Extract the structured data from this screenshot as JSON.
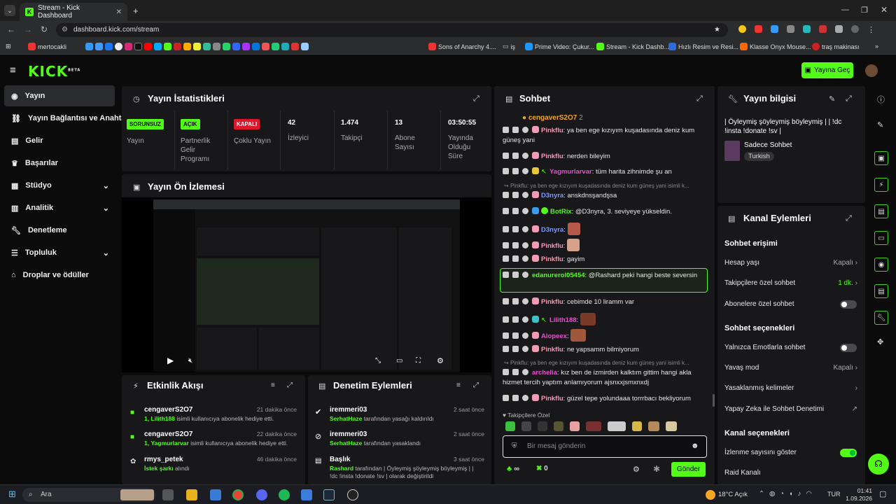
{
  "browser": {
    "tab_title": "Stream - Kick Dashboard",
    "url": "dashboard.kick.com/stream",
    "bookmarks": [
      "mertocakli",
      "Sons of Anarchy 4....",
      "iş",
      "Prime Video: Çukur...",
      "Stream - Kick Dashb...",
      "Hızlı Resim ve Resi...",
      "Klasse Onyx Mouse...",
      "traş makinası"
    ]
  },
  "header": {
    "logo": "KICK",
    "logo_sup": "BETA",
    "go_live": "Yayına Geç"
  },
  "sidebar": {
    "items": [
      {
        "label": "Yayın"
      },
      {
        "label": "Yayın Bağlantısı ve Anahtarı"
      },
      {
        "label": "Gelir"
      },
      {
        "label": "Başarılar"
      },
      {
        "label": "Stüdyo"
      },
      {
        "label": "Analitik"
      },
      {
        "label": "Denetleme"
      },
      {
        "label": "Topluluk"
      },
      {
        "label": "Droplar ve ödüller"
      }
    ]
  },
  "stats": {
    "title": "Yayın İstatistikleri",
    "items": [
      {
        "value": "SORUNSUZ",
        "label": "Yayın"
      },
      {
        "value": "AÇIK",
        "label": "Partnerlik Gelir Programı"
      },
      {
        "value": "KAPALI",
        "label": "Çoklu Yayın"
      },
      {
        "value": "42",
        "label": "İzleyici"
      },
      {
        "value": "1.474",
        "label": "Takipçi"
      },
      {
        "value": "13",
        "label": "Abone Sayısı"
      },
      {
        "value": "03:50:55",
        "label": "Yayında Olduğu Süre"
      }
    ]
  },
  "preview": {
    "title": "Yayın Ön İzlemesi"
  },
  "activity": {
    "title": "Etkinlik Akışı",
    "items": [
      {
        "user": "cengaverS2O7",
        "time": "21 dakika önce",
        "count": "1,",
        "target": "Lilith188",
        "text": "isimli kullanıcıya abonelik hediye etti."
      },
      {
        "user": "cengaverS2O7",
        "time": "22 dakika önce",
        "count": "1,",
        "target": "Yagmurlarvar",
        "text": "isimli kullanıcıya abonelik hediye etti."
      },
      {
        "user": "rmys_petek",
        "time": "46 dakika önce",
        "count": "",
        "target": "İstek şarkı",
        "text": "alındı"
      }
    ]
  },
  "moderation": {
    "title": "Denetim Eylemleri",
    "items": [
      {
        "user": "iremmeri03",
        "time": "2 saat önce",
        "actor": "SerhatHaze",
        "text": "tarafından yasağı kaldırıldı"
      },
      {
        "user": "iremmeri03",
        "time": "2 saat önce",
        "actor": "SerhatHaze",
        "text": "tarafından yasaklandı"
      },
      {
        "user": "Başlık",
        "time": "3 saat önce",
        "actor": "Rashard",
        "text": "tarafından | Öyleymiş şöyleymiş böyleymiş | | !dc !insta !donate !sv | olarak değiştirildi"
      }
    ]
  },
  "chat": {
    "title": "Sohbet",
    "pinned_user": "cengaverS2O7",
    "pinned_count": "2",
    "messages": [
      {
        "user": "Pinkflu",
        "text": "ya ben ege kızıyım kuşadasında deniz kum güneş yani",
        "color": "#f59ab4"
      },
      {
        "user": "Pinkflu",
        "text": "nerden bileyim",
        "color": "#f59ab4"
      },
      {
        "user": "Yagmurlarvar",
        "text": "tüm harita zihnimde şu an",
        "color": "#e84fd0"
      },
      {
        "user": "D3nyra",
        "text": "anskdnsşandşsa",
        "color": "#7b9cff"
      },
      {
        "user": "BotRix",
        "text": "@D3nyra, 3. seviyeye yükseldin.",
        "color": "#53fc18"
      },
      {
        "user": "D3nyra",
        "text": "",
        "color": "#7b9cff"
      },
      {
        "user": "Pinkflu",
        "text": "",
        "color": "#f59ab4"
      },
      {
        "user": "Pinkflu",
        "text": "gayim",
        "color": "#f59ab4"
      },
      {
        "user": "edanurerol05454",
        "text": "@Rashard peki hangi beste seversin",
        "color": "#53fc18"
      },
      {
        "user": "Pinkflu",
        "text": "cebimde 10 liramm var",
        "color": "#f59ab4"
      },
      {
        "user": "Lilith188",
        "text": "",
        "color": "#e84fd0"
      },
      {
        "user": "Alopeex",
        "text": "",
        "color": "#e84fd0"
      },
      {
        "user": "Pinkflu",
        "text": "ne yapsamm bilmiyorum",
        "color": "#f59ab4"
      },
      {
        "user": "archelia",
        "text": "kız ben de izmirden kalktım gittim hangi akla hizmet tercih yaptım anlamıyorum ajsnxxjsmxnxdj",
        "color": "#e84fd0"
      },
      {
        "user": "Pinkflu",
        "text": "güzel tepe yolundaaa torrrbacı bekliyorum",
        "color": "#f59ab4"
      }
    ],
    "reply1": "Pinkflu: ya ben ege kızıyım kuşadasında deniz kum güneş yani isimli k...",
    "reply2": "Pinkflu: ya ben ege kızıyım kuşadasında deniz kum güneş yani isimli k...",
    "emote_label": "Takipçilere Özel",
    "input_placeholder": "Bir mesaj gönderin",
    "points": "∞",
    "count": "0",
    "send": "Gönder"
  },
  "stream_info": {
    "title": "Yayın bilgisi",
    "stream_title": "| Öyleymiş şöyleymiş böyleymiş | | !dc !insta !donate !sv |",
    "category": "Sadece Sohbet",
    "tag": "Turkish"
  },
  "channel_actions": {
    "title": "Kanal Eylemleri",
    "chat_access": "Sohbet erişimi",
    "account_age": "Hesap yaşı",
    "account_age_val": "Kapalı",
    "followers_only": "Takipçilere özel sohbet",
    "followers_only_val": "1 dk.",
    "subs_only": "Abonelere özel sohbet",
    "chat_options": "Sohbet seçenekleri",
    "emotes_only": "Yalnızca Emotlarla sohbet",
    "slow_mode": "Yavaş mod",
    "slow_mode_val": "Kapalı",
    "banned_words": "Yasaklanmış kelimeler",
    "ai_moderation": "Yapay Zeka ile Sohbet Denetimi",
    "channel_options": "Kanal seçenekleri",
    "show_viewers": "İzlenme sayısını göster",
    "raid": "Raid Kanalı"
  },
  "taskbar": {
    "search": "Ara",
    "weather": "18°C",
    "weather_desc": "Açık",
    "lang": "TUR",
    "time": "01:41",
    "date": "1.09.2026"
  }
}
